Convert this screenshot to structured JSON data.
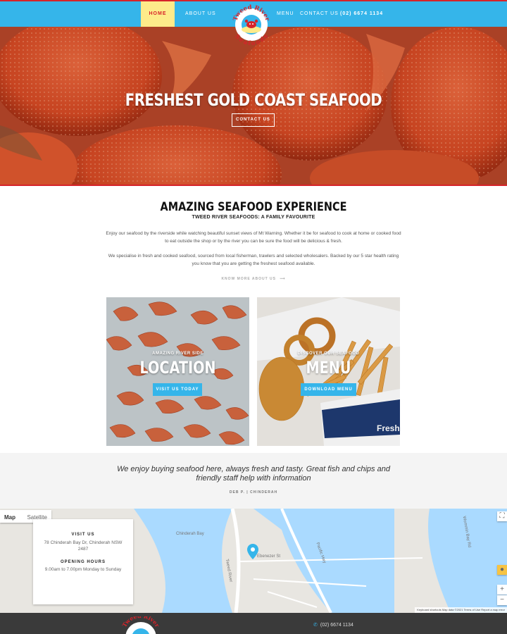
{
  "nav": {
    "home": "HOME",
    "about": "ABOUT US",
    "menu": "MENU",
    "contact": "CONTACT US",
    "phone": "(02) 6674 1134"
  },
  "logo": {
    "line1": "Tweed River",
    "line2": "Seafoods"
  },
  "hero": {
    "title": "FRESHEST GOLD COAST SEAFOOD",
    "button": "CONTACT US"
  },
  "intro": {
    "title": "AMAZING SEAFOOD EXPERIENCE",
    "subtitle": "TWEED RIVER SEAFOODS: A FAMILY FAVOURITE",
    "paragraph1": "Enjoy our seafood by the riverside while watching beautiful sunset views of Mt Warning. Whether it be for seafood to cook at home or cooked food to eat outside the shop or by the river you can be sure the food will be delicious & fresh.",
    "paragraph2": "We specialise in fresh and cooked seafood, sourced from local fisherman, trawlers and selected wholesalers. Backed by our 5 star health rating you know that you are getting the freshest seafood available.",
    "know_more": "KNOW MORE ABOUT US"
  },
  "tiles": [
    {
      "kicker": "AMAZING RIVER SIDE",
      "title": "LOCATION",
      "button": "VISIT US TODAY"
    },
    {
      "kicker": "DISCOVER OUR SEAFOOD",
      "title": "MENU",
      "button": "DOWNLOAD MENU",
      "box_text": "Fresh"
    }
  ],
  "testimonial": {
    "quote": "We enjoy buying seafood here, always fresh and tasty. Great fish and chips and friendly staff help with information",
    "author": "DEB P. | CHINDERAH"
  },
  "map": {
    "tab_map": "Map",
    "tab_satellite": "Satellite",
    "visit_heading": "VISIT US",
    "address": "78 Chinderah Bay Dr, Chinderah NSW 2487",
    "hours_heading": "OPENING HOURS",
    "hours": "9.00am to 7.00pm Monday to Sunday",
    "labels": {
      "chinderah_bay": "Chinderah Bay",
      "river": "Tweed River",
      "pacific_hwy": "Pacific Hwy",
      "road1": "Ebenezer St",
      "road2": "Wommin Bay Rd"
    },
    "attribution": "Keyboard shortcuts   Map data ©2021   Terms of Use   Report a map error"
  },
  "footer": {
    "phone": "(02) 6674 1134"
  },
  "colors": {
    "primary_blue": "#35b5ea",
    "accent_red": "#d6232a",
    "active_nav_yellow": "#fdeb8a",
    "footer_dark": "#3a3a3a"
  }
}
